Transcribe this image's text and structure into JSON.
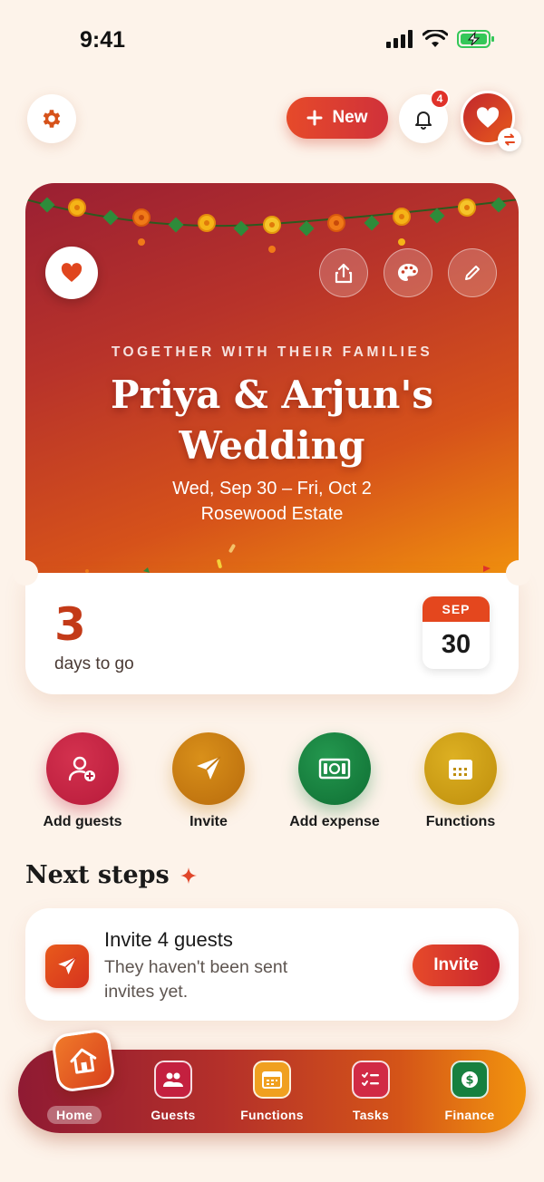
{
  "status_bar": {
    "time": "9:41"
  },
  "top_bar": {
    "new_label": "New",
    "notification_count": "4"
  },
  "hero": {
    "eyebrow": "TOGETHER WITH THEIR FAMILIES",
    "title_line1": "Priya & Arjun's",
    "title_line2": "Wedding",
    "dates": "Wed, Sep 30 – Fri, Oct 2",
    "venue": "Rosewood Estate"
  },
  "countdown": {
    "number": "3",
    "label": "days to go",
    "month": "SEP",
    "day": "30"
  },
  "quick_actions": [
    {
      "label": "Add guests",
      "icon": "add-person-icon",
      "color": "#c4203f"
    },
    {
      "label": "Invite",
      "icon": "send-icon",
      "color": "#c47a12"
    },
    {
      "label": "Add expense",
      "icon": "money-icon",
      "color": "#17803f"
    },
    {
      "label": "Functions",
      "icon": "calendar-icon",
      "color": "#c99a14"
    }
  ],
  "next_steps": {
    "title": "Next steps",
    "card": {
      "title": "Invite 4 guests",
      "description": "They haven't been sent invites yet.",
      "button": "Invite"
    }
  },
  "tabbar": [
    {
      "label": "Home",
      "icon": "home-icon"
    },
    {
      "label": "Guests",
      "icon": "guests-icon",
      "color": "#c4203f"
    },
    {
      "label": "Functions",
      "icon": "calendar-icon",
      "color": "#f0a020"
    },
    {
      "label": "Tasks",
      "icon": "checklist-icon",
      "color": "#c4203f"
    },
    {
      "label": "Finance",
      "icon": "dollar-icon",
      "color": "#17803f"
    }
  ]
}
